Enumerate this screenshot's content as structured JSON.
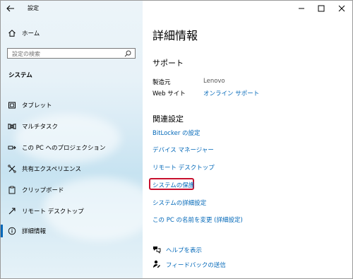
{
  "window": {
    "app_title": "設定",
    "controls": {
      "minimize": "—",
      "maximize": "☐",
      "close": "✕"
    }
  },
  "sidebar": {
    "home_label": "ホーム",
    "search_placeholder": "設定の検索",
    "section_title": "システム",
    "items": [
      {
        "label": "タブレット",
        "icon": "tablet-icon"
      },
      {
        "label": "マルチタスク",
        "icon": "multitasking-icon"
      },
      {
        "label": "この PC へのプロジェクション",
        "icon": "projection-icon"
      },
      {
        "label": "共有エクスペリエンス",
        "icon": "shared-experiences-icon"
      },
      {
        "label": "クリップボード",
        "icon": "clipboard-icon"
      },
      {
        "label": "リモート デスクトップ",
        "icon": "remote-desktop-icon"
      },
      {
        "label": "詳細情報",
        "icon": "info-icon",
        "selected": true
      }
    ]
  },
  "main": {
    "page_title": "詳細情報",
    "support": {
      "heading": "サポート",
      "manufacturer_label": "製造元",
      "manufacturer_value": "Lenovo",
      "website_label": "Web サイト",
      "website_link": "オンライン サポート"
    },
    "related": {
      "heading": "関連設定",
      "links": [
        "BitLocker の設定",
        "デバイス マネージャー",
        "リモート デスクトップ",
        "システムの保護",
        "システムの詳細設定",
        "この PC の名前を変更 (詳細設定)"
      ],
      "highlighted_index": 3
    },
    "help": {
      "get_help": "ヘルプを表示",
      "feedback": "フィードバックの送信"
    }
  },
  "colors": {
    "accent": "#0067b8",
    "highlight_border": "#c8102e"
  }
}
